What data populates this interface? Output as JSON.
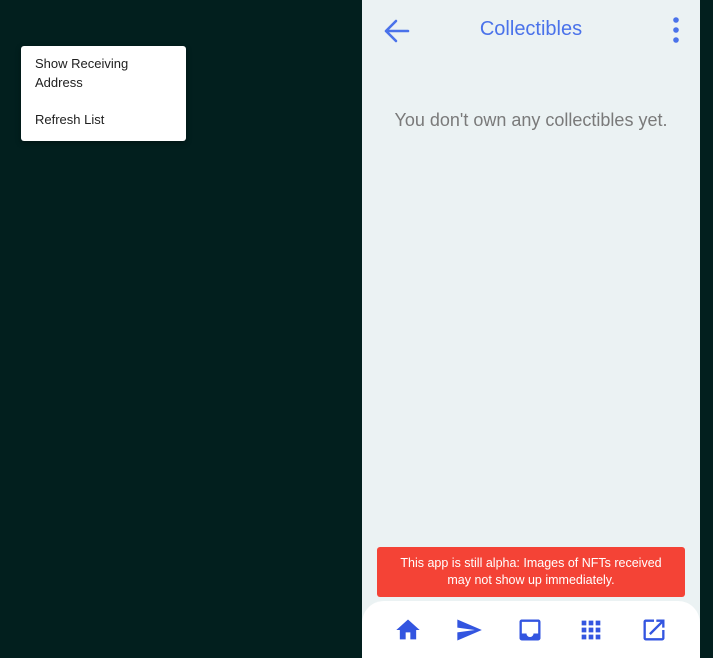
{
  "context_menu": {
    "items": [
      {
        "label": "Show Receiving Address"
      },
      {
        "label": "Refresh List"
      }
    ]
  },
  "header": {
    "back_icon": "arrow-left-icon",
    "title": "Collectibles",
    "more_icon": "more-vertical-icon"
  },
  "main": {
    "empty_message": "You don't own any collectibles yet."
  },
  "banner": {
    "text": "This app is still alpha: Images of NFTs received may not show up immediately."
  },
  "bottom_nav": {
    "items": [
      {
        "icon": "home-icon"
      },
      {
        "icon": "send-icon"
      },
      {
        "icon": "inbox-icon"
      },
      {
        "icon": "apps-grid-icon"
      },
      {
        "icon": "open-external-icon"
      }
    ]
  },
  "colors": {
    "background": "#021f1e",
    "panel": "#ebf2f3",
    "accent": "#4a72ea",
    "nav_icon": "#3355e0",
    "banner": "#f44336",
    "muted_text": "#7a7a7a"
  }
}
